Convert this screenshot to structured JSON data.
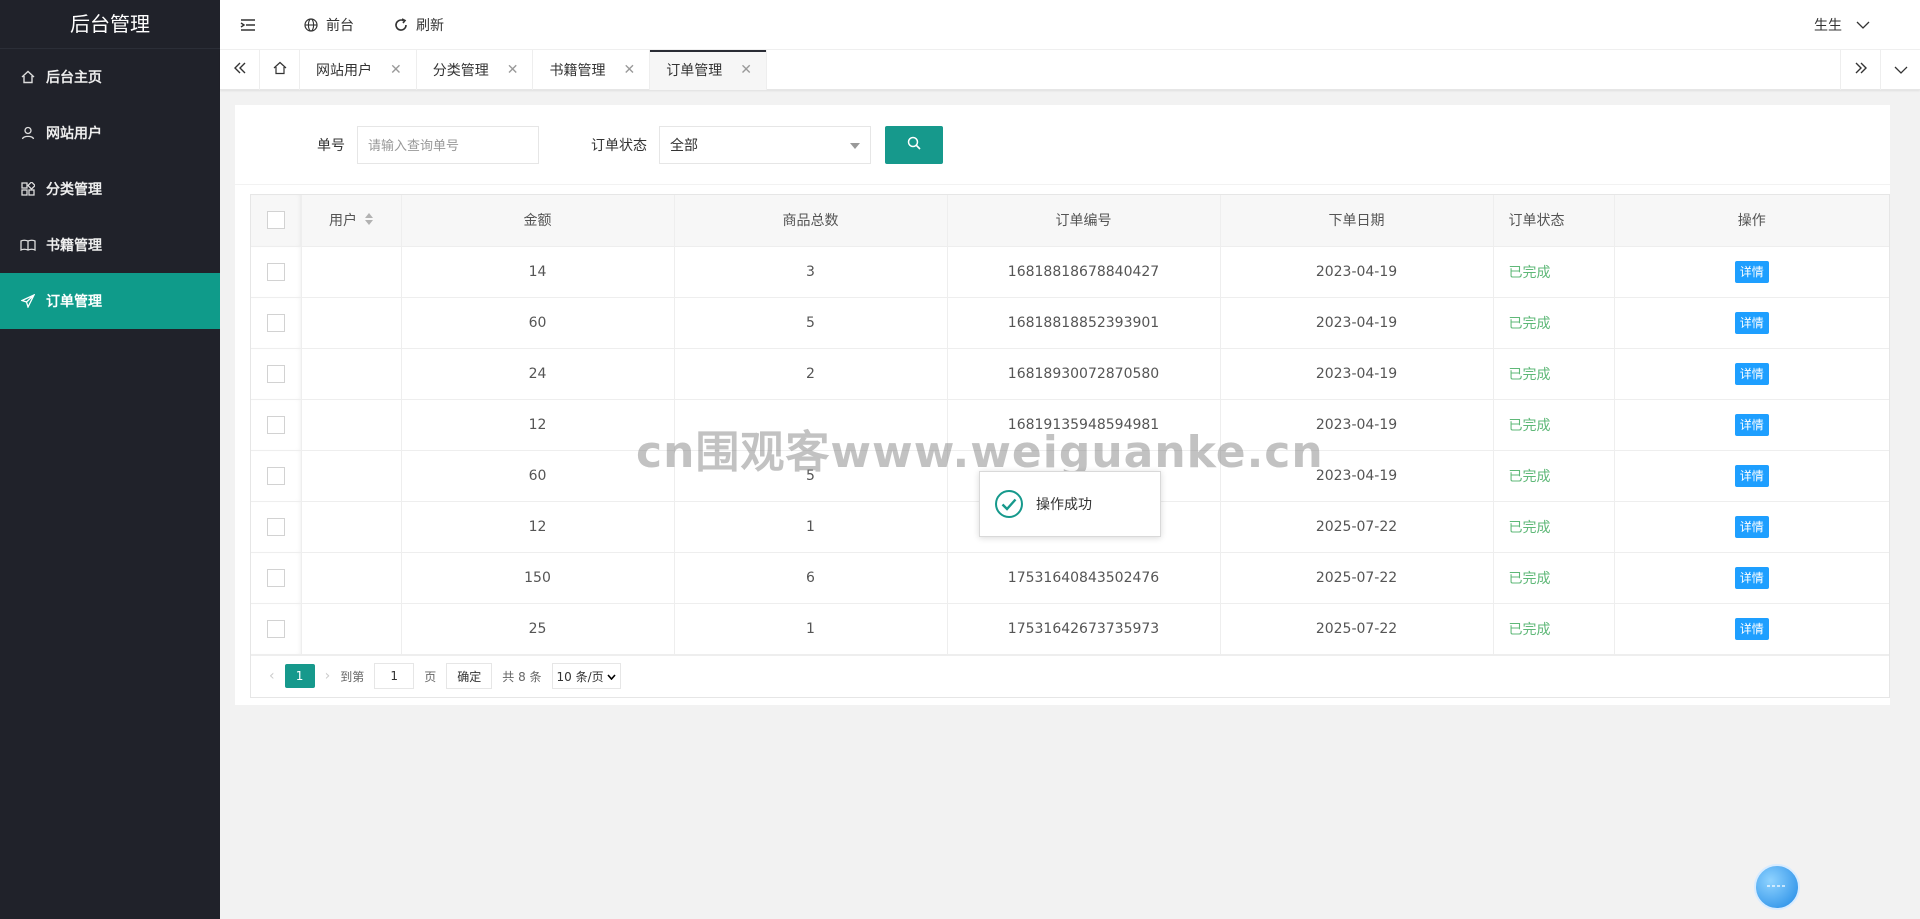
{
  "sidebar": {
    "logo": "后台管理",
    "items": [
      {
        "label": "后台主页",
        "icon": "home-icon"
      },
      {
        "label": "网站用户",
        "icon": "user-icon"
      },
      {
        "label": "分类管理",
        "icon": "apps-icon"
      },
      {
        "label": "书籍管理",
        "icon": "book-icon"
      },
      {
        "label": "订单管理",
        "icon": "send-icon",
        "active": true
      }
    ]
  },
  "header": {
    "front_label": "前台",
    "refresh_label": "刷新",
    "user_name": "生生"
  },
  "tabs": [
    {
      "label": "网站用户"
    },
    {
      "label": "分类管理"
    },
    {
      "label": "书籍管理"
    },
    {
      "label": "订单管理",
      "active": true
    }
  ],
  "search": {
    "order_no_label": "单号",
    "order_no_placeholder": "请输入查询单号",
    "status_label": "订单状态",
    "status_value": "全部"
  },
  "table": {
    "headers": [
      "用户",
      "金额",
      "商品总数",
      "订单编号",
      "下单日期",
      "订单状态",
      "操作"
    ],
    "rows": [
      {
        "user": "",
        "amount": "14",
        "count": "3",
        "order_no": "16818818678840427",
        "date": "2023-04-19",
        "status": "已完成",
        "action": "详情"
      },
      {
        "user": "",
        "amount": "60",
        "count": "5",
        "order_no": "16818818852393901",
        "date": "2023-04-19",
        "status": "已完成",
        "action": "详情"
      },
      {
        "user": "",
        "amount": "24",
        "count": "2",
        "order_no": "16818930072870580",
        "date": "2023-04-19",
        "status": "已完成",
        "action": "详情"
      },
      {
        "user": "",
        "amount": "12",
        "count": "",
        "order_no": "16819135948594981",
        "date": "2023-04-19",
        "status": "已完成",
        "action": "详情"
      },
      {
        "user": "",
        "amount": "60",
        "count": "5",
        "order_no": "",
        "date": "2023-04-19",
        "status": "已完成",
        "action": "详情"
      },
      {
        "user": "",
        "amount": "12",
        "count": "1",
        "order_no": "",
        "date": "2025-07-22",
        "status": "已完成",
        "action": "详情"
      },
      {
        "user": "",
        "amount": "150",
        "count": "6",
        "order_no": "17531640843502476",
        "date": "2025-07-22",
        "status": "已完成",
        "action": "详情"
      },
      {
        "user": "",
        "amount": "25",
        "count": "1",
        "order_no": "17531642673735973",
        "date": "2025-07-22",
        "status": "已完成",
        "action": "详情"
      }
    ]
  },
  "pager": {
    "current": "1",
    "goto_label": "到第",
    "goto_value": "1",
    "page_unit": "页",
    "confirm_label": "确定",
    "total_label": "共 8 条",
    "limit_label": "10 条/页"
  },
  "toast": {
    "message": "操作成功"
  },
  "watermark": "cn围观客www.weiguanke.cn",
  "colors": {
    "accent": "#16998c",
    "sidebar": "#20222a",
    "status": "#5fb878",
    "detail_button": "#1e9fff"
  }
}
